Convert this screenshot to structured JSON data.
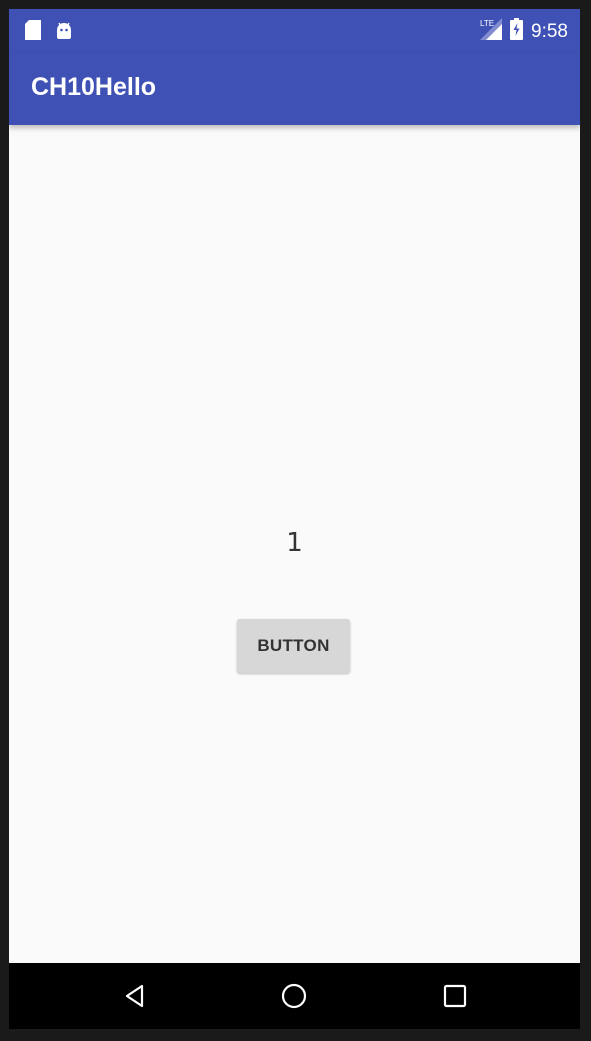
{
  "status_bar": {
    "time": "9:58",
    "icons": [
      "sd-card-icon",
      "android-icon",
      "signal-icon",
      "battery-charging-icon"
    ]
  },
  "app_bar": {
    "title": "CH10Hello"
  },
  "main": {
    "counter_value": "1",
    "button_label": "BUTTON"
  },
  "nav_bar": {
    "icons": [
      "back-icon",
      "home-icon",
      "recents-icon"
    ]
  },
  "colors": {
    "primary": "#3f51b5",
    "background": "#fafafa",
    "button_bg": "#d7d7d7"
  }
}
